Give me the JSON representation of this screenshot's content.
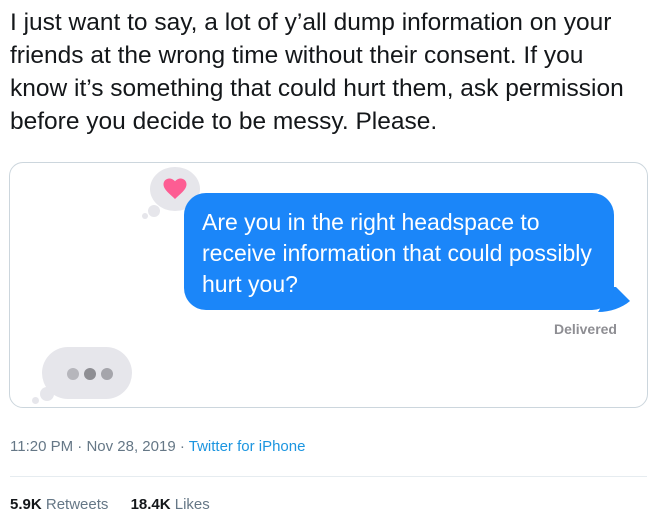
{
  "tweet": {
    "text": "I just want to say, a lot of y’all dump information on your friends at the wrong time without their consent. If you know it’s something that could hurt them, ask permission before you decide to be messy. Please."
  },
  "image": {
    "message": "Are you in the right headspace to receive information that could possibly hurt you?",
    "status": "Delivered",
    "reaction_icon": "heart-icon",
    "typing_icon": "typing-indicator-icon",
    "accent_color": "#1b86f9",
    "heart_color": "#fd5d93"
  },
  "meta": {
    "time": "11:20 PM",
    "separator": " · ",
    "date": "Nov 28, 2019",
    "separator2": " · ",
    "source": "Twitter for iPhone"
  },
  "stats": {
    "retweets_count": "5.9K",
    "retweets_label": " Retweets",
    "likes_count": "18.4K",
    "likes_label": " Likes"
  }
}
